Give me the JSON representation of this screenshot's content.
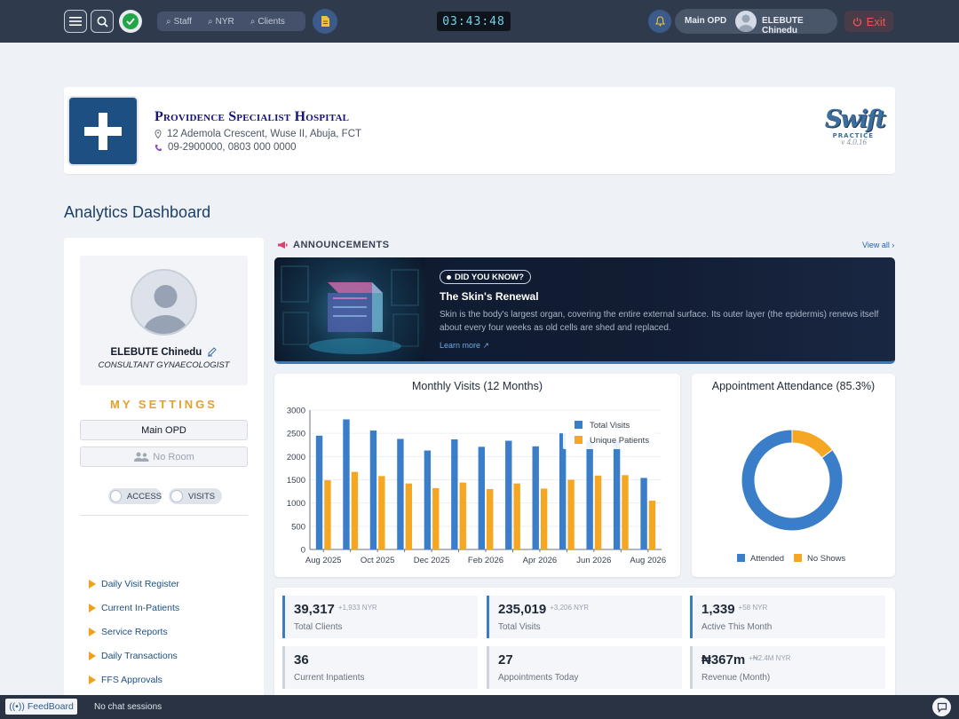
{
  "topbar": {
    "search_staff": "Staff",
    "search_nyr": "NYR",
    "search_clients": "Clients",
    "clock": "03:43:48",
    "location": "Main OPD",
    "user_name": "ELEBUTE Chinedu",
    "exit_label": "Exit",
    "colors": {
      "bg": "#2f3a4d",
      "exit": "#f05454",
      "ok": "#22a447"
    }
  },
  "hospital": {
    "name": "Providence Specialist Hospital",
    "address": "12 Ademola Crescent, Wuse II, Abuja, FCT",
    "phone": "09-2900000, 0803 000 0000",
    "brand": "Swift",
    "brand_sub": "PRACTICE",
    "version": "v 4.0.16"
  },
  "page_title": "Analytics Dashboard",
  "profile": {
    "name": "ELEBUTE Chinedu",
    "role": "CONSULTANT GYNAECOLOGIST",
    "settings_heading": "MY SETTINGS",
    "location": "Main OPD",
    "room": "No Room",
    "toggle_access": "ACCESS",
    "toggle_visits": "VISITS"
  },
  "menu": [
    {
      "label": "Daily Visit Register"
    },
    {
      "label": "Current In-Patients"
    },
    {
      "label": "Service Reports"
    },
    {
      "label": "Daily Transactions"
    },
    {
      "label": "FFS Approvals"
    }
  ],
  "announcements": {
    "heading": "ANNOUNCEMENTS",
    "view_all": "View all ›",
    "chip": "DID YOU KNOW?",
    "title": "The Skin's Renewal",
    "body": "Skin is the body's largest organ, covering the entire external surface. Its outer layer (the epidermis) renews itself about every four weeks as old cells are shed and replaced.",
    "learn_more": "Learn more ↗"
  },
  "chart_data": [
    {
      "type": "bar",
      "title": "Monthly Visits (12 Months)",
      "categories": [
        "Aug 2025",
        "Sep 2025",
        "Oct 2025",
        "Nov 2025",
        "Dec 2025",
        "Jan 2026",
        "Feb 2026",
        "Mar 2026",
        "Apr 2026",
        "May 2026",
        "Jun 2026",
        "Jul 2026",
        "Aug 2026"
      ],
      "tick_labels": [
        "Aug 2025",
        "Oct 2025",
        "Dec 2025",
        "Feb 2026",
        "Apr 2026",
        "Jun 2026",
        "Aug 2026"
      ],
      "series": [
        {
          "name": "Total Visits",
          "color": "#3a7dc9",
          "values": [
            2450,
            2800,
            2560,
            2380,
            2130,
            2370,
            2210,
            2340,
            2220,
            2500,
            2340,
            2340,
            1540
          ]
        },
        {
          "name": "Unique Patients",
          "color": "#f5a623",
          "values": [
            1490,
            1670,
            1580,
            1420,
            1320,
            1440,
            1300,
            1420,
            1310,
            1500,
            1590,
            1600,
            1050
          ]
        }
      ],
      "ylim": [
        0,
        3000
      ],
      "yticks": [
        0,
        500,
        1000,
        1500,
        2000,
        2500,
        3000
      ],
      "legend": "top-right",
      "grid": true
    },
    {
      "type": "pie",
      "title": "Appointment Attendance (85.3%)",
      "labels": [
        "Attended",
        "No Shows"
      ],
      "values": [
        85.3,
        14.7
      ],
      "colors": [
        "#3a7dc9",
        "#f5a623"
      ],
      "legend": "bottom"
    }
  ],
  "stats": [
    {
      "value": "39,317",
      "delta": "+1,933 NYR",
      "label": "Total Clients"
    },
    {
      "value": "235,019",
      "delta": "+3,206 NYR",
      "label": "Total Visits"
    },
    {
      "value": "1,339",
      "delta": "+58 NYR",
      "label": "Active This Month"
    },
    {
      "value": "36",
      "delta": "",
      "label": "Current Inpatients"
    },
    {
      "value": "27",
      "delta": "",
      "label": "Appointments Today"
    },
    {
      "value": "₦367m",
      "delta": "+₦2.4M NYR",
      "label": "Revenue (Month)"
    }
  ],
  "bottombar": {
    "feedboard": "FeedBoard",
    "chat_status": "No chat sessions"
  }
}
